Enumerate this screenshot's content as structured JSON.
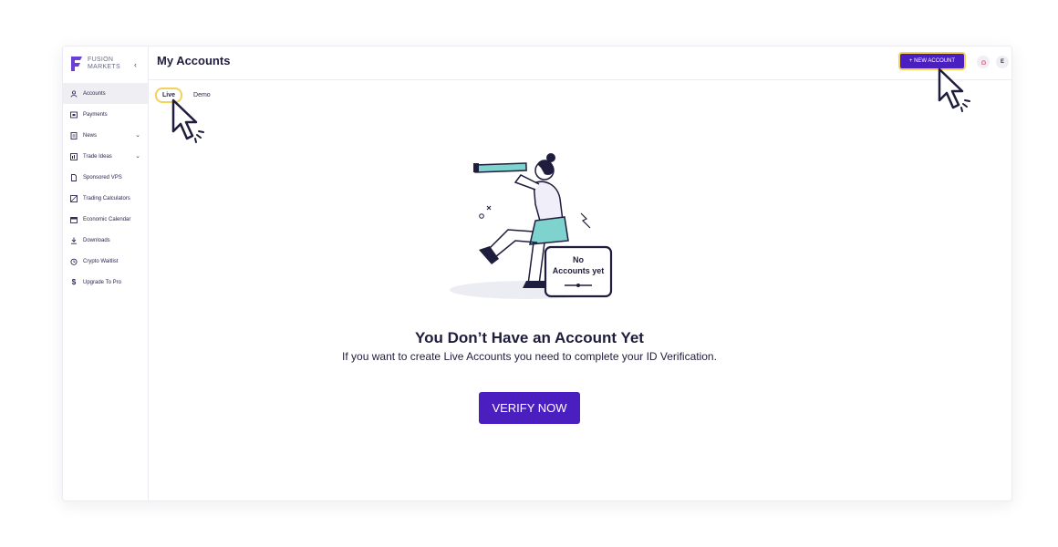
{
  "sidebar": {
    "logo_line1": "FUSION",
    "logo_line2": "MARKETS",
    "collapse_glyph": "‹",
    "items": [
      {
        "label": "Accounts",
        "icon": "user-icon",
        "active": true
      },
      {
        "label": "Payments",
        "icon": "wallet-icon"
      },
      {
        "label": "News",
        "icon": "news-icon",
        "expandable": true
      },
      {
        "label": "Trade Ideas",
        "icon": "chart-icon",
        "expandable": true
      },
      {
        "label": "Sponsored VPS",
        "icon": "document-icon"
      },
      {
        "label": "Trading Calculators",
        "icon": "calculator-icon"
      },
      {
        "label": "Economic Calendar",
        "icon": "calendar-icon"
      },
      {
        "label": "Downloads",
        "icon": "download-icon"
      },
      {
        "label": "Crypto Waitlist",
        "icon": "clock-icon"
      },
      {
        "label": "Upgrade To Pro",
        "icon": "dollar-icon"
      }
    ]
  },
  "header": {
    "title": "My Accounts",
    "new_account_label": "+ NEW ACCOUNT",
    "user_initial": "E"
  },
  "tabs": [
    {
      "label": "Live",
      "active": true
    },
    {
      "label": "Demo"
    }
  ],
  "empty_state": {
    "bubble_line1": "No",
    "bubble_line2": "Accounts yet",
    "title": "You Don’t Have an Account Yet",
    "subtitle": "If you want to create Live Accounts you need to complete your ID Verification.",
    "button": "VERIFY NOW"
  },
  "colors": {
    "accent": "#4b1fbf",
    "highlight": "#f3d15b",
    "text": "#1f1d3d",
    "teal": "#7ed3cf"
  }
}
